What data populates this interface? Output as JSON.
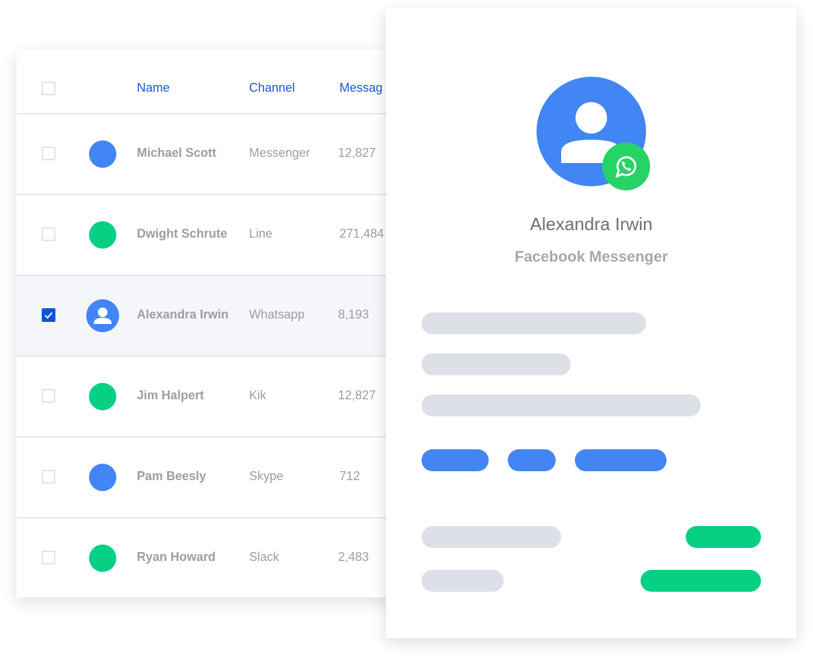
{
  "table": {
    "headers": {
      "name": "Name",
      "channel": "Channel",
      "messages": "Messag"
    },
    "rows": [
      {
        "name": "Michael Scott",
        "channel": "Messenger",
        "messages": "12,827",
        "avatar_color": "#4285f4",
        "checked": false
      },
      {
        "name": "Dwight Schrute",
        "channel": "Line",
        "messages": "271,484",
        "avatar_color": "#05d084",
        "checked": false
      },
      {
        "name": "Alexandra Irwin",
        "channel": "Whatsapp",
        "messages": "8,193",
        "avatar_color": "#4285f4",
        "checked": true
      },
      {
        "name": "Jim Halpert",
        "channel": "Kik",
        "messages": "12,827",
        "avatar_color": "#05d084",
        "checked": false
      },
      {
        "name": "Pam Beesly",
        "channel": "Skype",
        "messages": "712",
        "avatar_color": "#4285f4",
        "checked": false
      },
      {
        "name": "Ryan Howard",
        "channel": "Slack",
        "messages": "2,483",
        "avatar_color": "#05d084",
        "checked": false
      }
    ]
  },
  "detail": {
    "name": "Alexandra Irwin",
    "channel": "Facebook Messenger",
    "badge_icon": "whatsapp-icon"
  },
  "colors": {
    "accent_blue": "#4285f4",
    "header_blue": "#1a56db",
    "checkbox_blue": "#0b57d0",
    "green": "#05d084",
    "whatsapp_green": "#25d366",
    "placeholder_gray": "#dde1e7"
  }
}
